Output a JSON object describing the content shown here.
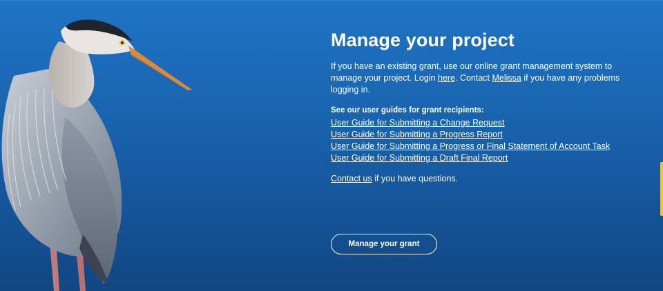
{
  "main": {
    "title": "Manage your project",
    "intro": {
      "before_login": "If you have an existing grant, use our online grant management system to manage your project. Login ",
      "login_link": "here",
      "between": ". Contact ",
      "contact_name_link": "Melissa",
      "after": " if you have any problems logging in."
    },
    "guides_heading": "See our user guides for grant recipients:",
    "guides": [
      "User Guide for Submitting a Change Request",
      "User Guide for Submitting a Progress Report",
      "User Guide for Submitting a Progress or Final Statement of Account Task",
      "User Guide for Submitting a Draft Final Report"
    ],
    "contact": {
      "link": "Contact us",
      "text": " if you have questions."
    },
    "cta_label": "Manage your grant"
  },
  "colors": {
    "background_top": "#1f74c4",
    "background_bottom": "#114683",
    "text": "#ffffff",
    "side_tab": "#f2c230"
  }
}
